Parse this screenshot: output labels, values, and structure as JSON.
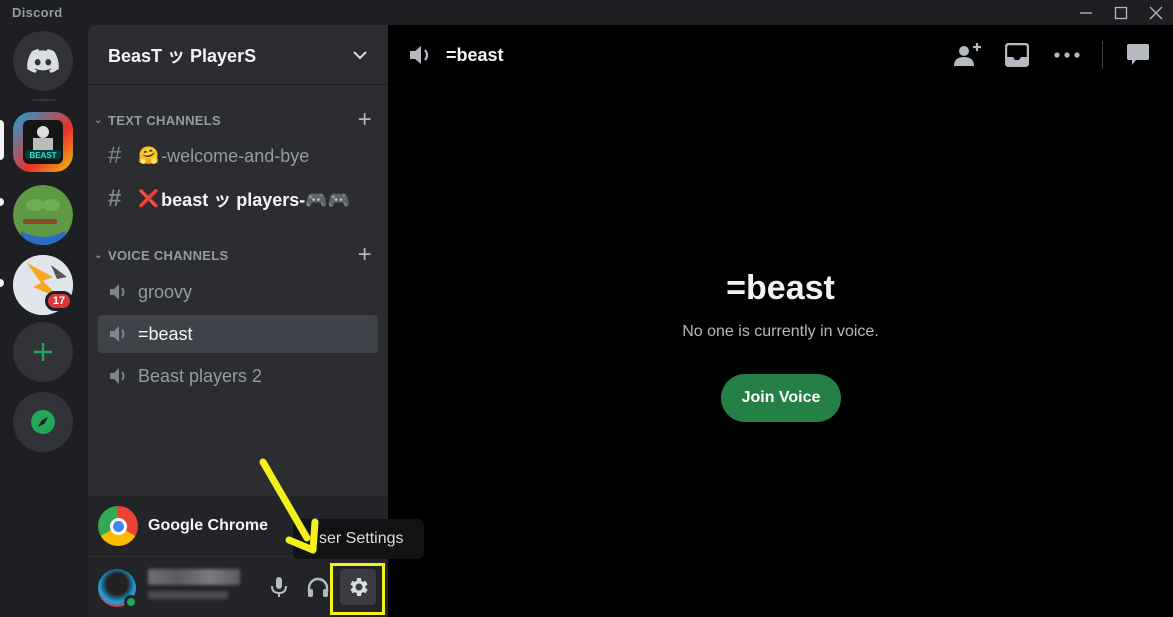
{
  "window": {
    "title": "Discord"
  },
  "guilds": {
    "items": [
      {
        "name": "Direct Messages",
        "icon": "discord-logo-icon"
      },
      {
        "name": "BeasT ッ PlayerS",
        "icon": "beast-server-icon",
        "active": true
      },
      {
        "name": "Pepe server",
        "icon": "pepe-server-icon",
        "unread": true
      },
      {
        "name": "Lightning server",
        "icon": "lightning-server-icon",
        "unread": true,
        "mention_count": "17"
      },
      {
        "name": "Add a Server",
        "icon": "plus-icon"
      },
      {
        "name": "Explore Discoverable Servers",
        "icon": "compass-icon"
      }
    ]
  },
  "sidebar": {
    "server_name": "BeasT ッ PlayerS",
    "categories": [
      {
        "label": "TEXT CHANNELS"
      },
      {
        "label": "VOICE CHANNELS"
      }
    ],
    "text_channels": [
      {
        "emoji": "🤗",
        "name": "-welcome-and-bye",
        "unread": false
      },
      {
        "emoji": "❌",
        "name": "beast ッ players-🎮🎮",
        "unread": true
      }
    ],
    "voice_channels": [
      {
        "name": "groovy",
        "selected": false
      },
      {
        "name": "=beast",
        "selected": true
      },
      {
        "name": "Beast players 2",
        "selected": false
      }
    ],
    "activity": {
      "name": "Google Chrome"
    },
    "tooltip": "ser Settings"
  },
  "main": {
    "channel_name": "=beast",
    "empty_title": "=beast",
    "empty_subtitle": "No one is currently in voice.",
    "join_button": "Join Voice"
  },
  "colors": {
    "accent_green": "#248046",
    "highlight": "#f4f01c",
    "mention_red": "#da373c"
  }
}
